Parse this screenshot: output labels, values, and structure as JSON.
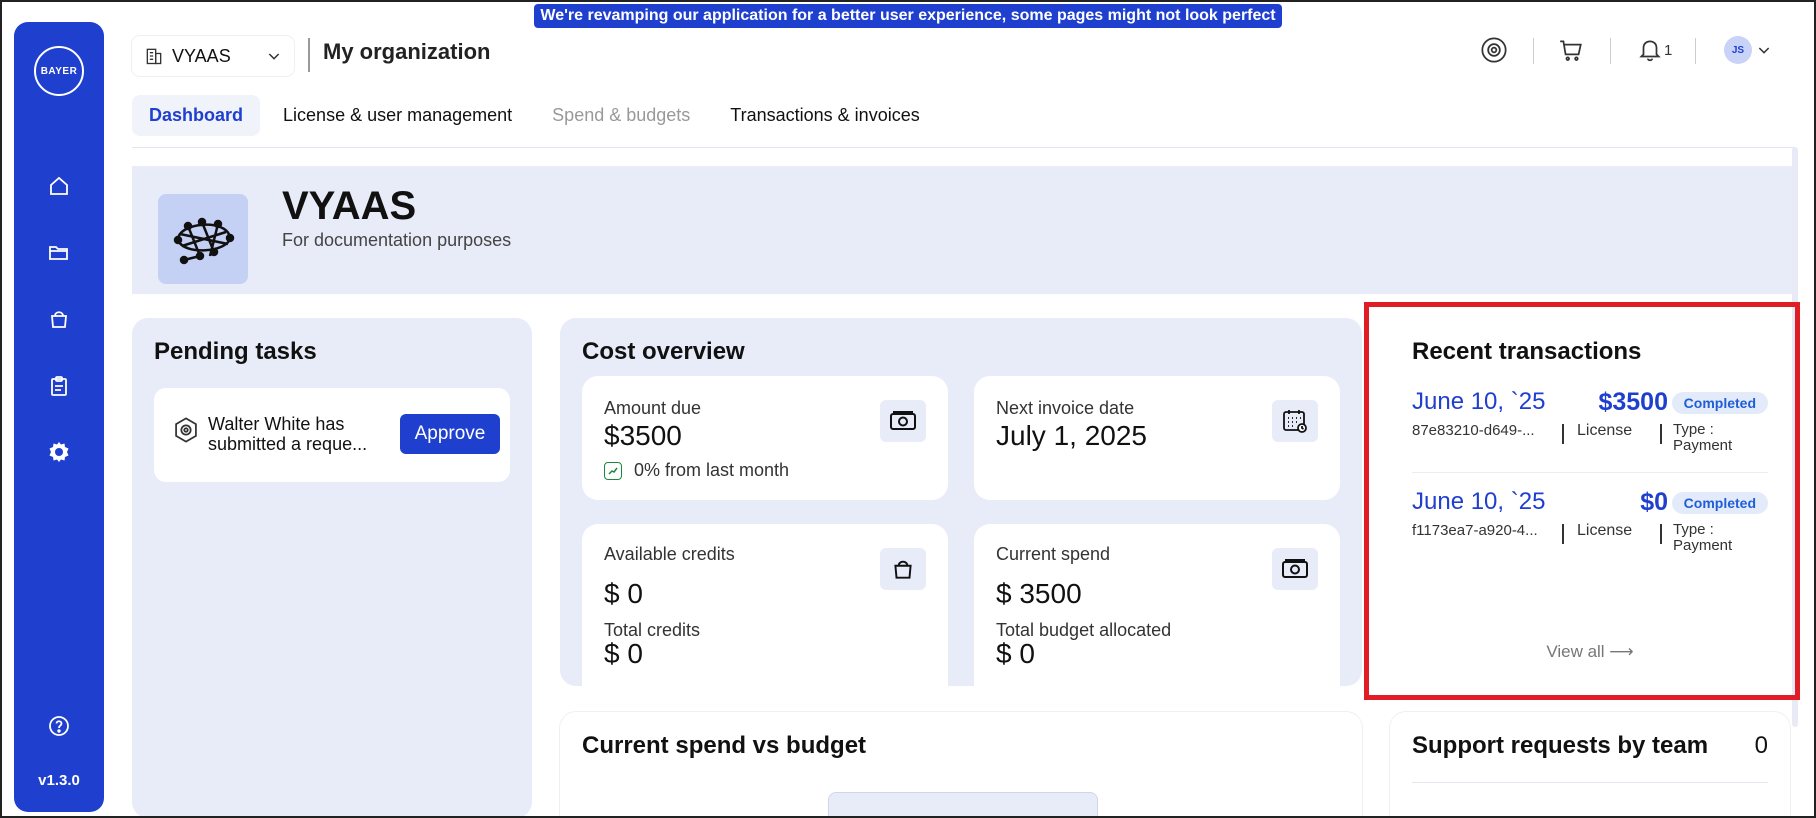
{
  "banner": "We're revamping our application for a better user experience, some pages might not look perfect yet!",
  "sidebar": {
    "logo_text": "BAYER",
    "items": [
      {
        "name": "home-icon"
      },
      {
        "name": "folder-icon"
      },
      {
        "name": "bag-icon"
      },
      {
        "name": "clipboard-icon"
      },
      {
        "name": "settings-icon",
        "active": true
      }
    ],
    "help_icon": "help-icon",
    "version": "v1.3.0"
  },
  "header": {
    "org_select_value": "VYAAS",
    "title": "My organization",
    "notification_count": "1",
    "avatar_initials": "JS"
  },
  "tabs": [
    {
      "label": "Dashboard",
      "state": "active"
    },
    {
      "label": "License & user management",
      "state": "normal"
    },
    {
      "label": "Spend & budgets",
      "state": "disabled"
    },
    {
      "label": "Transactions & invoices",
      "state": "normal"
    }
  ],
  "hero": {
    "title": "VYAAS",
    "subtitle": "For documentation purposes"
  },
  "pending": {
    "title": "Pending tasks",
    "task_text": "Walter White has submitted a reque...",
    "approve_label": "Approve"
  },
  "cost": {
    "title": "Cost overview",
    "amount_due_label": "Amount due",
    "amount_due_value": "$3500",
    "amount_due_trend": "0% from last month",
    "next_invoice_label": "Next invoice date",
    "next_invoice_value": "July 1, 2025",
    "available_credits_label": "Available credits",
    "available_credits_value": "$ 0",
    "total_credits_label": "Total credits",
    "total_credits_value": "$ 0",
    "current_spend_label": "Current spend",
    "current_spend_value": "$ 3500",
    "total_budget_label": "Total budget allocated",
    "total_budget_value": "$ 0"
  },
  "recent": {
    "title": "Recent transactions",
    "transactions": [
      {
        "date": "June 10, `25",
        "amount": "$3500",
        "status": "Completed",
        "id": "87e83210-d649-...",
        "license": "License",
        "type": "Type : Payment"
      },
      {
        "date": "June 10, `25",
        "amount": "$0",
        "status": "Completed",
        "id": "f1173ea7-a920-4...",
        "license": "License",
        "type": "Type : Payment"
      }
    ],
    "view_all": "View all ⟶"
  },
  "spend_vs_budget": {
    "title": "Current spend vs budget"
  },
  "support": {
    "title": "Support requests by team",
    "count": "0"
  },
  "colors": {
    "primary": "#1f3fcf",
    "panel": "#e8ecf8",
    "highlight": "#e01c24"
  }
}
